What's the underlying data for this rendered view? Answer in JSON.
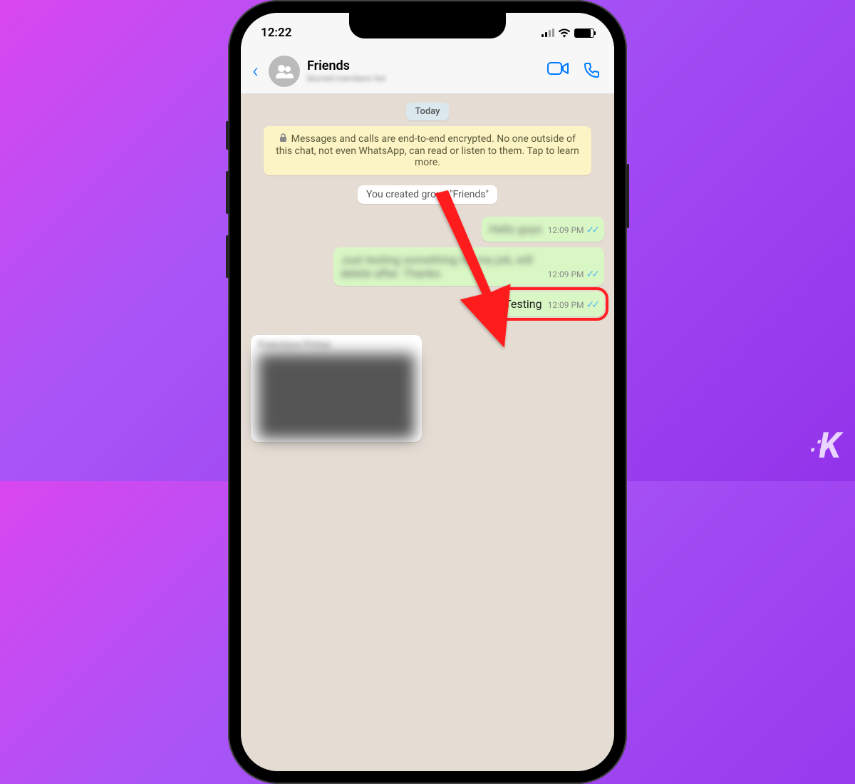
{
  "status": {
    "time": "12:22"
  },
  "nav": {
    "title": "Friends",
    "subtitle": "blurred members list"
  },
  "chat": {
    "date_label": "Today",
    "encryption_notice": "Messages and calls are end-to-end encrypted. No one outside of this chat, not even WhatsApp, can read or listen to them. Tap to learn more.",
    "system_message": "You created group \"Friends\"",
    "messages": [
      {
        "text": "Hello guys",
        "time": "12:09 PM",
        "blurred": true
      },
      {
        "text": "Just testing something for my job, will delete after. Thanks",
        "time": "12:09 PM",
        "blurred": true
      },
      {
        "text": "Testing",
        "time": "12:09 PM",
        "blurred": false,
        "highlighted": true
      }
    ],
    "incoming": {
      "sender": "Francisco Primo"
    }
  },
  "watermark": "K"
}
